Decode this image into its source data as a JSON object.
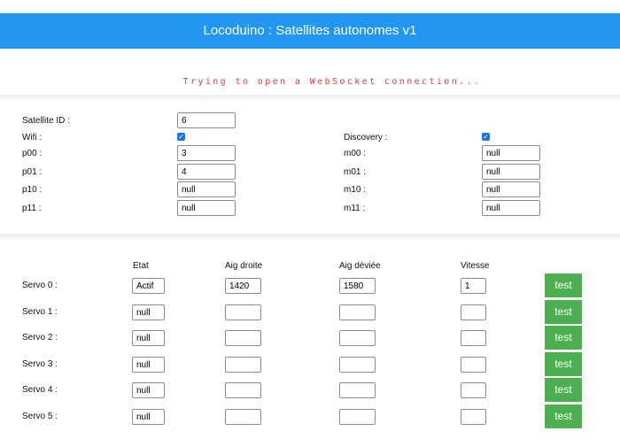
{
  "header": {
    "title": "Locoduino : Satellites autonomes v1"
  },
  "status": {
    "message": "Trying to open a WebSocket connection..."
  },
  "config": {
    "satellite_id": {
      "label": "Satellite ID :",
      "value": "6"
    },
    "wifi": {
      "label": "Wifi :",
      "checked": true
    },
    "discovery": {
      "label": "Discovery :",
      "checked": true
    },
    "p00": {
      "label": "p00 :",
      "value": "3"
    },
    "p01": {
      "label": "p01 :",
      "value": "4"
    },
    "p10": {
      "label": "p10 :",
      "value": "null"
    },
    "p11": {
      "label": "p11 :",
      "value": "null"
    },
    "m00": {
      "label": "m00 :",
      "value": "null"
    },
    "m01": {
      "label": "m01 :",
      "value": "null"
    },
    "m10": {
      "label": "m10 :",
      "value": "null"
    },
    "m11": {
      "label": "m11 :",
      "value": "null"
    }
  },
  "servos": {
    "headers": {
      "etat": "Etat",
      "aig_droite": "Aig droite",
      "aig_deviee": "Aig déviée",
      "vitesse": "Vitesse"
    },
    "test_label": "test",
    "rows": [
      {
        "label": "Servo 0 :",
        "etat": "Actif",
        "aig_droite": "1420",
        "aig_deviee": "1580",
        "vitesse": "1"
      },
      {
        "label": "Servo 1 :",
        "etat": "null",
        "aig_droite": "",
        "aig_deviee": "",
        "vitesse": ""
      },
      {
        "label": "Servo 2 :",
        "etat": "null",
        "aig_droite": "",
        "aig_deviee": "",
        "vitesse": ""
      },
      {
        "label": "Servo 3 :",
        "etat": "null",
        "aig_droite": "",
        "aig_deviee": "",
        "vitesse": ""
      },
      {
        "label": "Servo 4 :",
        "etat": "null",
        "aig_droite": "",
        "aig_deviee": "",
        "vitesse": ""
      },
      {
        "label": "Servo 5 :",
        "etat": "null",
        "aig_droite": "",
        "aig_deviee": "",
        "vitesse": ""
      }
    ]
  },
  "colors": {
    "header": "#2196f3",
    "status": "#e53935",
    "button": "#4caf50",
    "checkbox": "#1a73e8"
  }
}
